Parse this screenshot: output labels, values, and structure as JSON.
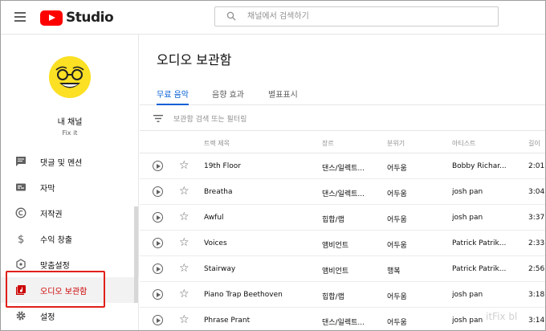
{
  "app": {
    "name": "Studio"
  },
  "search": {
    "placeholder": "채널에서 검색하기"
  },
  "channel": {
    "title": "내 채널",
    "subtitle": "Fix it"
  },
  "sidebar": {
    "items": [
      {
        "label": "댓글 및 멘션",
        "icon": "comment-icon"
      },
      {
        "label": "자막",
        "icon": "subtitles-icon"
      },
      {
        "label": "저작권",
        "icon": "copyright-icon"
      },
      {
        "label": "수익 창출",
        "icon": "dollar-icon"
      },
      {
        "label": "맞춤설정",
        "icon": "customization-icon"
      },
      {
        "label": "오디오 보관함",
        "icon": "audio-library-icon",
        "active": true
      },
      {
        "label": "설정",
        "icon": "gear-icon"
      }
    ]
  },
  "main": {
    "title": "오디오 보관함",
    "tabs": [
      {
        "label": "무료 음악",
        "active": true
      },
      {
        "label": "음향 효과"
      },
      {
        "label": "별표표시"
      }
    ],
    "filter_placeholder": "보관함 검색 또는 필터링",
    "columns": [
      "트랙 제목",
      "장르",
      "분위기",
      "아티스트",
      "길이"
    ],
    "rows": [
      {
        "title": "19th Floor",
        "genre": "댄스/일렉트...",
        "mood": "어두움",
        "artist": "Bobby Richar...",
        "length": "2:01"
      },
      {
        "title": "Breatha",
        "genre": "댄스/일렉트...",
        "mood": "어두움",
        "artist": "josh pan",
        "length": "3:04"
      },
      {
        "title": "Awful",
        "genre": "힙합/랩",
        "mood": "어두움",
        "artist": "josh pan",
        "length": "3:37"
      },
      {
        "title": "Voices",
        "genre": "앰비언트",
        "mood": "어두움",
        "artist": "Patrick Patrik...",
        "length": "2:33"
      },
      {
        "title": "Stairway",
        "genre": "앰비언트",
        "mood": "행복",
        "artist": "Patrick Patrik...",
        "length": "2:56"
      },
      {
        "title": "Piano Trap Beethoven",
        "genre": "힙합/랩",
        "mood": "어두움",
        "artist": "josh pan",
        "length": "3:18"
      },
      {
        "title": "Phrase Prant",
        "genre": "댄스/일렉트...",
        "mood": "어두움",
        "artist": "josh pan",
        "length": "3:14"
      }
    ]
  },
  "watermark": "itFix bl",
  "colors": {
    "accent": "#065fd4",
    "brand": "#ff0000",
    "active_nav": "#cc0000",
    "highlight_box": "#e0201a"
  }
}
